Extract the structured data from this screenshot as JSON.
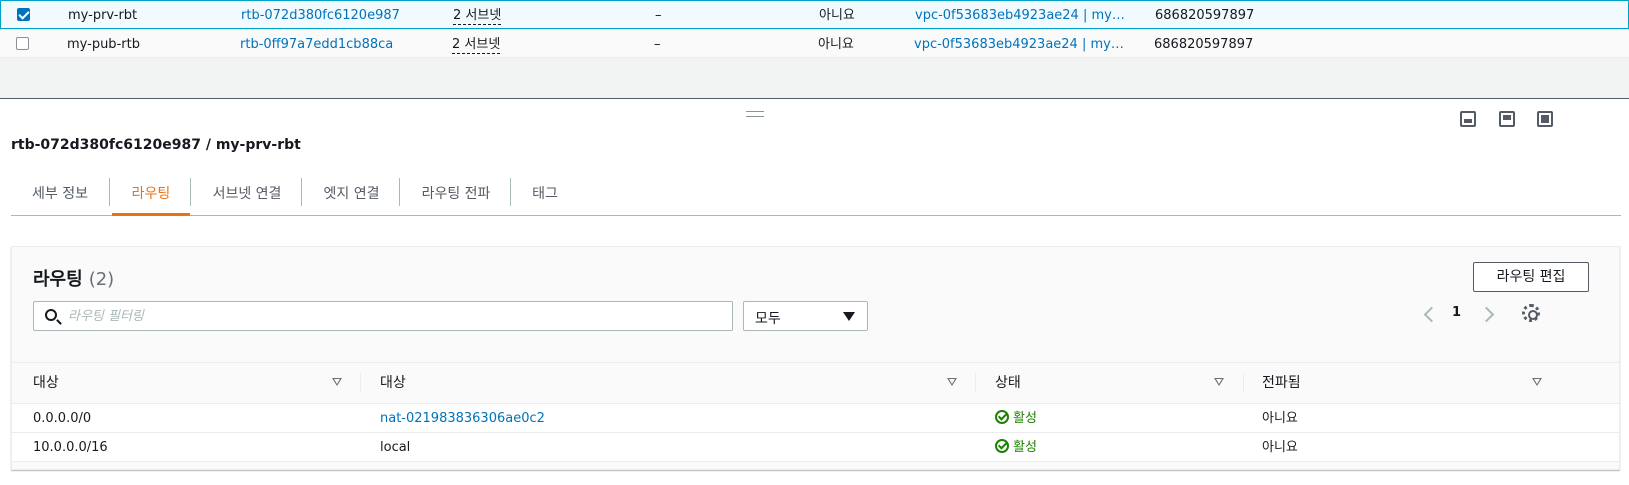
{
  "top_table": {
    "rows": [
      {
        "checked": true,
        "name": "my-prv-rbt",
        "id": "rtb-072d380fc6120e987",
        "subnets": "2 서브넷",
        "edge": "–",
        "main": "아니요",
        "vpc": "vpc-0f53683eb4923ae24 | my…",
        "owner": "686820597897"
      },
      {
        "checked": false,
        "name": "my-pub-rtb",
        "id": "rtb-0ff97a7edd1cb88ca",
        "subnets": "2 서브넷",
        "edge": "–",
        "main": "아니요",
        "vpc": "vpc-0f53683eb4923ae24 | my…",
        "owner": "686820597897"
      }
    ]
  },
  "panel": {
    "title": "rtb-072d380fc6120e987 / my-prv-rbt",
    "tabs": [
      "세부 정보",
      "라우팅",
      "서브넷 연결",
      "엣지 연결",
      "라우팅 전파",
      "태그"
    ],
    "active_tab": 1
  },
  "routes": {
    "title": "라우팅",
    "count": "(2)",
    "edit_label": "라우팅 편집",
    "search_placeholder": "라우팅 필터링",
    "filter_value": "모두",
    "page": "1",
    "columns": [
      "대상",
      "대상",
      "상태",
      "전파됨"
    ],
    "rows": [
      {
        "destination": "0.0.0.0/0",
        "target": "nat-021983836306ae0c2",
        "target_link": true,
        "status": "활성",
        "propagated": "아니요"
      },
      {
        "destination": "10.0.0.0/16",
        "target": "local",
        "target_link": false,
        "status": "활성",
        "propagated": "아니요"
      }
    ]
  },
  "icons": {
    "search": "search-icon",
    "settings": "gear-icon",
    "status": "check-circle-icon"
  },
  "colors": {
    "accent": "#ec7211",
    "link": "#0073bb",
    "success": "#1d8102",
    "checkbox": "#0073bb"
  }
}
